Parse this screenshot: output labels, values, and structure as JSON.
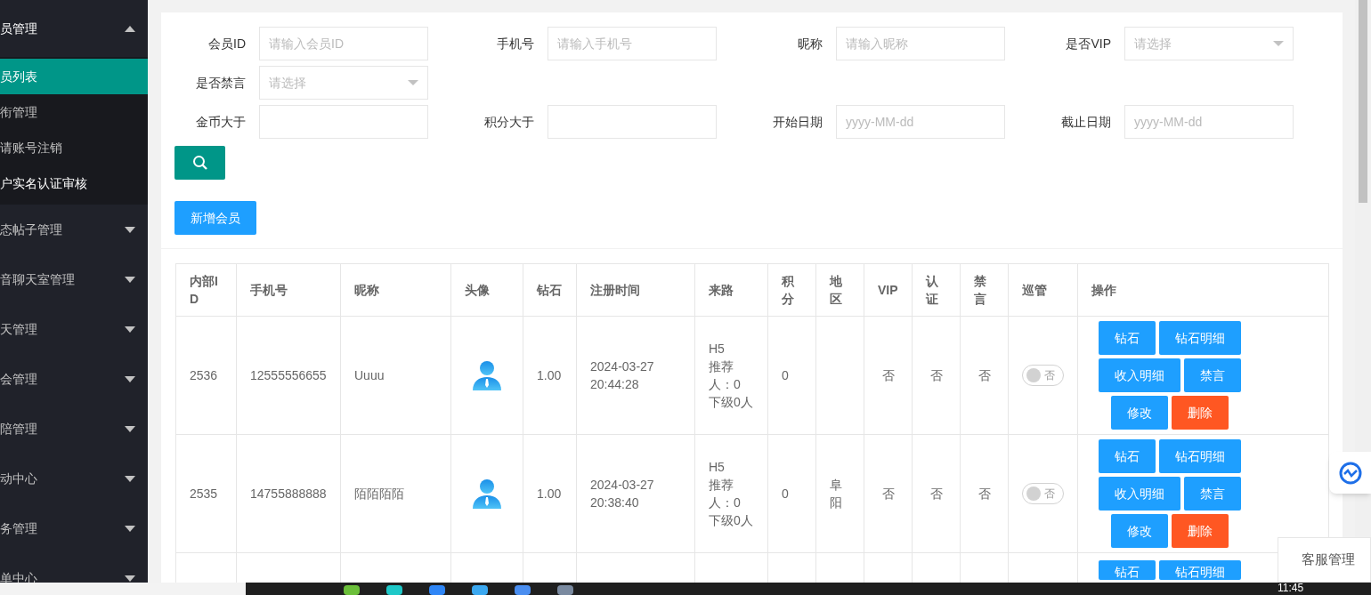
{
  "sidebar": {
    "items": [
      {
        "label": "员管理",
        "expanded": true,
        "children": [
          {
            "label": "员列表",
            "selected": true
          },
          {
            "label": "衔管理",
            "selected": false
          },
          {
            "label": "请账号注销",
            "selected": false
          },
          {
            "label": "户实名认证审核",
            "selected": false
          }
        ]
      },
      {
        "label": "态帖子管理",
        "expanded": false
      },
      {
        "label": "音聊天室管理",
        "expanded": false
      },
      {
        "label": "天管理",
        "expanded": false
      },
      {
        "label": "会管理",
        "expanded": false
      },
      {
        "label": "陪管理",
        "expanded": false
      },
      {
        "label": "动中心",
        "expanded": false
      },
      {
        "label": "务管理",
        "expanded": false
      },
      {
        "label": "单中心",
        "expanded": false
      }
    ]
  },
  "filters": [
    {
      "label": "会员ID",
      "kind": "text",
      "placeholder": "请输入会员ID"
    },
    {
      "label": "手机号",
      "kind": "text",
      "placeholder": "请输入手机号"
    },
    {
      "label": "昵称",
      "kind": "text",
      "placeholder": "请输入昵称"
    },
    {
      "label": "是否VIP",
      "kind": "select",
      "placeholder": "请选择"
    },
    {
      "label": "是否禁言",
      "kind": "select",
      "placeholder": "请选择"
    },
    {
      "label": "金币大于",
      "kind": "text"
    },
    {
      "label": "积分大于",
      "kind": "text"
    },
    {
      "label": "开始日期",
      "kind": "text",
      "placeholder": "yyyy-MM-dd"
    },
    {
      "label": "截止日期",
      "kind": "text",
      "placeholder": "yyyy-MM-dd"
    }
  ],
  "add_button": "新增会员",
  "table": {
    "columns": [
      "内部ID",
      "手机号",
      "昵称",
      "头像",
      "钻石",
      "注册时间",
      "来路",
      "积分",
      "地区",
      "VIP",
      "认证",
      "禁言",
      "巡管",
      "操作"
    ],
    "rows": [
      {
        "id": "2536",
        "phone": "12555556655",
        "nickname": "Uuuu",
        "avatar": true,
        "diamonds": "1.00",
        "registered": [
          "2024-03-27",
          "20:44:28"
        ],
        "source": [
          "H5",
          "推荐",
          "人：0",
          "下级0人"
        ],
        "points": "0",
        "region": "",
        "vip": "否",
        "verified": "否",
        "muted": "否",
        "patrol": {
          "on": false,
          "label": "否"
        },
        "actions": [
          {
            "label": "钻石",
            "kind": "normal"
          },
          {
            "label": "钻石明细",
            "kind": "normal"
          },
          {
            "label": "收入明细",
            "kind": "normal"
          },
          {
            "label": "禁言",
            "kind": "normal"
          },
          {
            "label": "修改",
            "kind": "normal"
          },
          {
            "label": "删除",
            "kind": "danger"
          }
        ]
      },
      {
        "id": "2535",
        "phone": "14755888888",
        "nickname": "陌陌陌陌",
        "avatar": true,
        "diamonds": "1.00",
        "registered": [
          "2024-03-27",
          "20:38:40"
        ],
        "source": [
          "H5",
          "推荐",
          "人：0",
          "下级0人"
        ],
        "points": "0",
        "region": "阜阳",
        "vip": "否",
        "verified": "否",
        "muted": "否",
        "patrol": {
          "on": false,
          "label": "否"
        },
        "actions": [
          {
            "label": "钻石",
            "kind": "normal"
          },
          {
            "label": "钻石明细",
            "kind": "normal"
          },
          {
            "label": "收入明细",
            "kind": "normal"
          },
          {
            "label": "禁言",
            "kind": "normal"
          },
          {
            "label": "修改",
            "kind": "normal"
          },
          {
            "label": "删除",
            "kind": "danger"
          }
        ]
      },
      {
        "actions": [
          {
            "label": "钻石",
            "kind": "normal"
          },
          {
            "label": "钻石明细",
            "kind": "normal"
          }
        ]
      }
    ]
  },
  "service_popup": "客服管理",
  "taskbar": {
    "clock": "11:45"
  }
}
